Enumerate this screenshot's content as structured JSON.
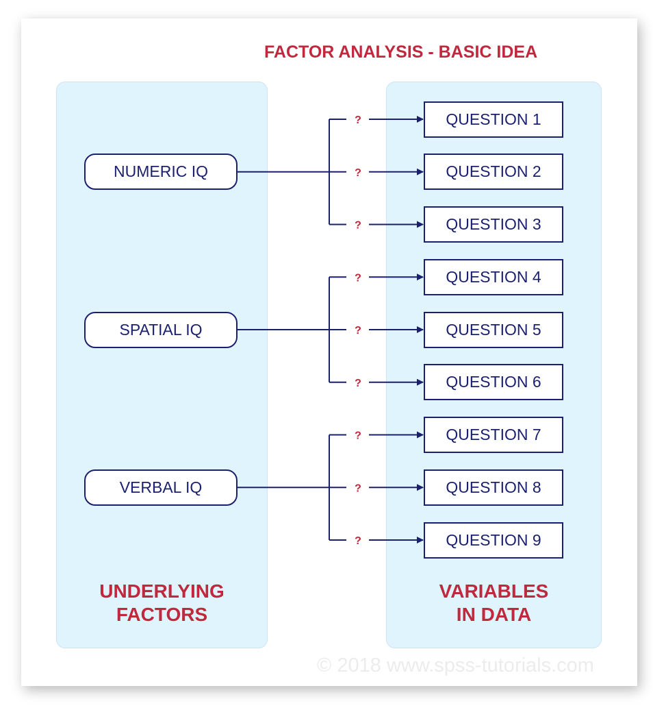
{
  "title": "FACTOR ANALYSIS - BASIC IDEA",
  "left_panel": {
    "label_line1": "UNDERLYING",
    "label_line2": "FACTORS"
  },
  "right_panel": {
    "label_line1": "VARIABLES",
    "label_line2": "IN DATA"
  },
  "factors": [
    {
      "label": "NUMERIC IQ",
      "questions": [
        0,
        1,
        2
      ]
    },
    {
      "label": "SPATIAL IQ",
      "questions": [
        3,
        4,
        5
      ]
    },
    {
      "label": "VERBAL IQ",
      "questions": [
        6,
        7,
        8
      ]
    }
  ],
  "questions": [
    {
      "label": "QUESTION 1"
    },
    {
      "label": "QUESTION 2"
    },
    {
      "label": "QUESTION 3"
    },
    {
      "label": "QUESTION 4"
    },
    {
      "label": "QUESTION 5"
    },
    {
      "label": "QUESTION 6"
    },
    {
      "label": "QUESTION 7"
    },
    {
      "label": "QUESTION 8"
    },
    {
      "label": "QUESTION 9"
    }
  ],
  "link_label": "?",
  "watermark": "© 2018 www.spss-tutorials.com",
  "colors": {
    "accent_red": "#c0283d",
    "navy": "#1a1f6e",
    "panel_blue": "#dff4fd"
  }
}
